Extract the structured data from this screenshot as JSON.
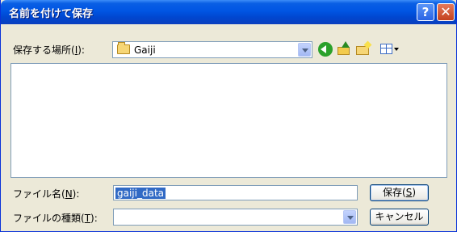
{
  "window": {
    "title": "名前を付けて保存",
    "help_glyph": "?",
    "close_glyph": "✕"
  },
  "location": {
    "label_prefix": "保存する場所(",
    "label_key": "I",
    "label_suffix": "):",
    "folder": "Gaiji"
  },
  "toolbar": {
    "icons": [
      "back-icon",
      "up-folder-icon",
      "new-folder-icon",
      "view-menu-icon"
    ]
  },
  "filename": {
    "label_prefix": "ファイル名(",
    "label_key": "N",
    "label_suffix": "):",
    "value": "gaiji_data"
  },
  "filetype": {
    "label_prefix": "ファイルの種類(",
    "label_key": "T",
    "label_suffix": "):",
    "value": ""
  },
  "buttons": {
    "save_prefix": "保存(",
    "save_key": "S",
    "save_suffix": ")",
    "cancel": "キャンセル"
  },
  "colors": {
    "titlebar": "#0055E3",
    "dialog_bg": "#ECE9D8",
    "selection": "#316AC5"
  }
}
